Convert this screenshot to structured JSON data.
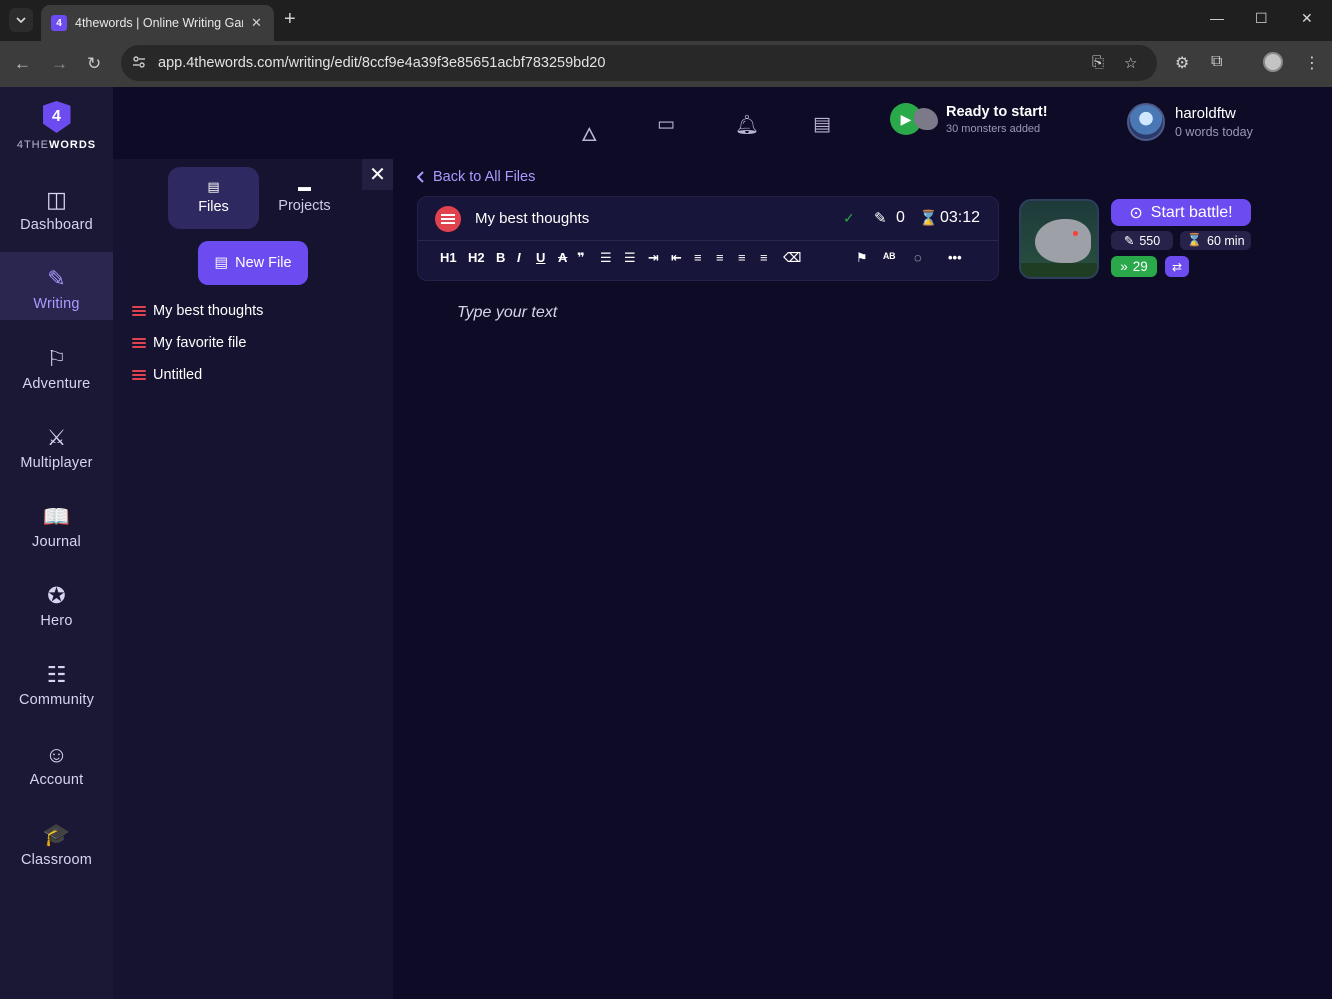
{
  "browser": {
    "tab_title": "4thewords | Online Writing Gam",
    "tab_close": "✕",
    "new_tab": "+",
    "url": "app.4thewords.com/writing/edit/8ccf9e4a39f3e85651acbf783259bd20",
    "win_minimize": "—",
    "win_maximize": "☐",
    "win_close": "✕"
  },
  "logo": {
    "mark": "4",
    "word_a": "4THE",
    "word_b": "WORDS"
  },
  "sidebar": {
    "items": [
      {
        "label": "Dashboard",
        "icon": "◫"
      },
      {
        "label": "Writing",
        "icon": "✎"
      },
      {
        "label": "Adventure",
        "icon": "⚐"
      },
      {
        "label": "Multiplayer",
        "icon": "⚔"
      },
      {
        "label": "Journal",
        "icon": "📖"
      },
      {
        "label": "Hero",
        "icon": "✪"
      },
      {
        "label": "Community",
        "icon": "☷"
      },
      {
        "label": "Account",
        "icon": "☺"
      },
      {
        "label": "Classroom",
        "icon": "🎓"
      }
    ]
  },
  "panel": {
    "tab_files": "Files",
    "tab_projects": "Projects",
    "close": "✕",
    "new_file": "New File",
    "files": [
      "My best thoughts",
      "My favorite file",
      "Untitled"
    ]
  },
  "header": {
    "ready_title": "Ready to start!",
    "ready_sub": "30 monsters added",
    "username": "haroldftw",
    "words_today": "0 words today"
  },
  "editor": {
    "back": "Back to All Files",
    "file_name": "My best thoughts",
    "word_count": "0",
    "timer": "03:12",
    "placeholder": "Type your text",
    "tools": [
      "H1",
      "H2",
      "B",
      "I",
      "U",
      "A",
      "❞",
      "☰",
      "☰",
      "⇥",
      "⇤",
      "≡",
      "≡",
      "≡",
      "≡",
      "⌫",
      "⚑",
      "ᴬᴮ",
      "◌",
      "•••"
    ]
  },
  "battle": {
    "start": "Start battle!",
    "words_goal": "550",
    "time_goal": "60 min",
    "streak": "29"
  },
  "colors": {
    "accent": "#6c4cf1",
    "bg": "#0e0b26",
    "sidebar": "#1b1835",
    "green": "#2aa94b",
    "red": "#e0434e"
  }
}
